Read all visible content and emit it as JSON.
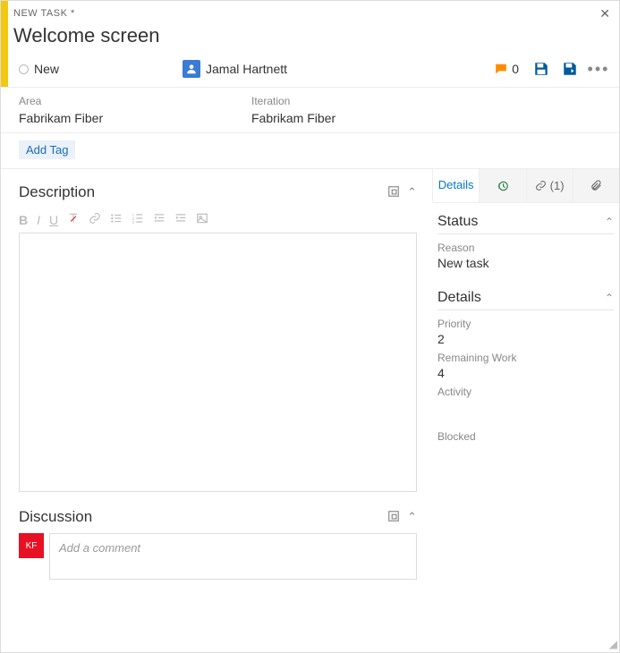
{
  "header": {
    "type_label": "NEW TASK *",
    "title": "Welcome screen",
    "state": "New",
    "assignee": "Jamal Hartnett",
    "comment_count": "0"
  },
  "classification": {
    "area_label": "Area",
    "area_value": "Fabrikam Fiber",
    "iteration_label": "Iteration",
    "iteration_value": "Fabrikam Fiber"
  },
  "tags": {
    "add_tag_label": "Add Tag"
  },
  "sections": {
    "description_title": "Description",
    "discussion_title": "Discussion"
  },
  "discussion": {
    "avatar_initials": "KF",
    "placeholder": "Add a comment"
  },
  "tabs": {
    "details": "Details",
    "links_count": "(1)"
  },
  "right_panel": {
    "status_title": "Status",
    "reason_label": "Reason",
    "reason_value": "New task",
    "details_title": "Details",
    "priority_label": "Priority",
    "priority_value": "2",
    "remaining_label": "Remaining Work",
    "remaining_value": "4",
    "activity_label": "Activity",
    "blocked_label": "Blocked"
  },
  "colors": {
    "accent_yellow": "#f2c811",
    "brand_blue": "#0078d4",
    "avatar_red": "#e81123"
  }
}
